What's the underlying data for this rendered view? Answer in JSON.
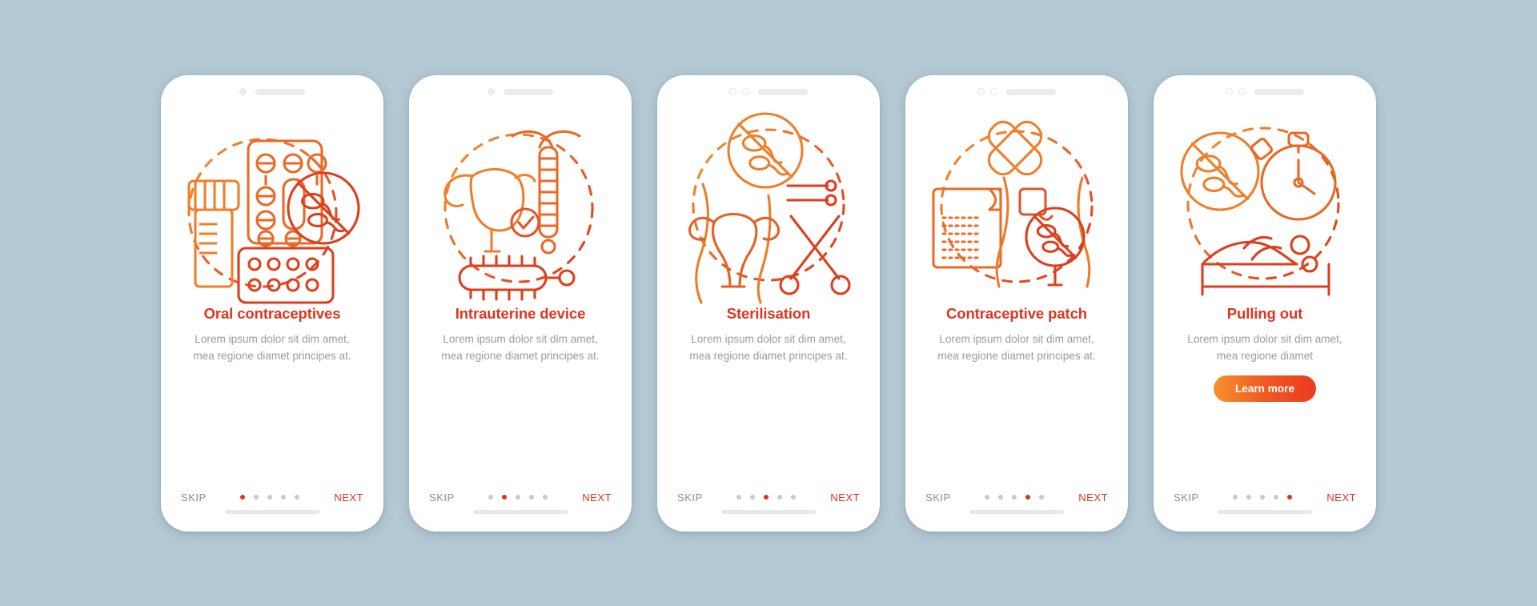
{
  "background_color": "#b4c9d4",
  "accent": {
    "title_color": "#e0341f",
    "body_color": "#9b9b9b",
    "dot_active_color": "#e0341f",
    "dot_inactive_color": "#c9c9c9",
    "skip_color": "#8e8e8e",
    "next_color": "#e0341f",
    "button_gradient_start": "#f7922e",
    "button_gradient_end": "#ea3c1e"
  },
  "nav_labels": {
    "skip": "SKIP",
    "next": "NEXT"
  },
  "total_steps": 5,
  "screens": [
    {
      "index": 1,
      "notch_circles": 1,
      "illustration_name": "oral-contraceptives-illustration",
      "title": "Oral contraceptives",
      "body": "Lorem ipsum dolor sit dim amet, mea regione diamet principes at.",
      "has_learn_more": false,
      "learn_more_label": "",
      "active_dot": 1
    },
    {
      "index": 2,
      "notch_circles": 1,
      "illustration_name": "intrauterine-device-illustration",
      "title": "Intrauterine device",
      "body": "Lorem ipsum dolor sit dim amet, mea regione diamet principes at.",
      "has_learn_more": false,
      "learn_more_label": "",
      "active_dot": 2
    },
    {
      "index": 3,
      "notch_circles": 2,
      "illustration_name": "sterilisation-illustration",
      "title": "Sterilisation",
      "body": "Lorem ipsum dolor sit dim amet, mea regione diamet principes at.",
      "has_learn_more": false,
      "learn_more_label": "",
      "active_dot": 3
    },
    {
      "index": 4,
      "notch_circles": 2,
      "illustration_name": "contraceptive-patch-illustration",
      "title": "Contraceptive patch",
      "body": "Lorem ipsum dolor sit dim amet, mea regione diamet principes at.",
      "has_learn_more": false,
      "learn_more_label": "",
      "active_dot": 4
    },
    {
      "index": 5,
      "notch_circles": 2,
      "illustration_name": "pulling-out-illustration",
      "title": "Pulling out",
      "body": "Lorem ipsum dolor sit dim amet, mea regione diamet",
      "has_learn_more": true,
      "learn_more_label": "Learn more",
      "active_dot": 5
    }
  ]
}
